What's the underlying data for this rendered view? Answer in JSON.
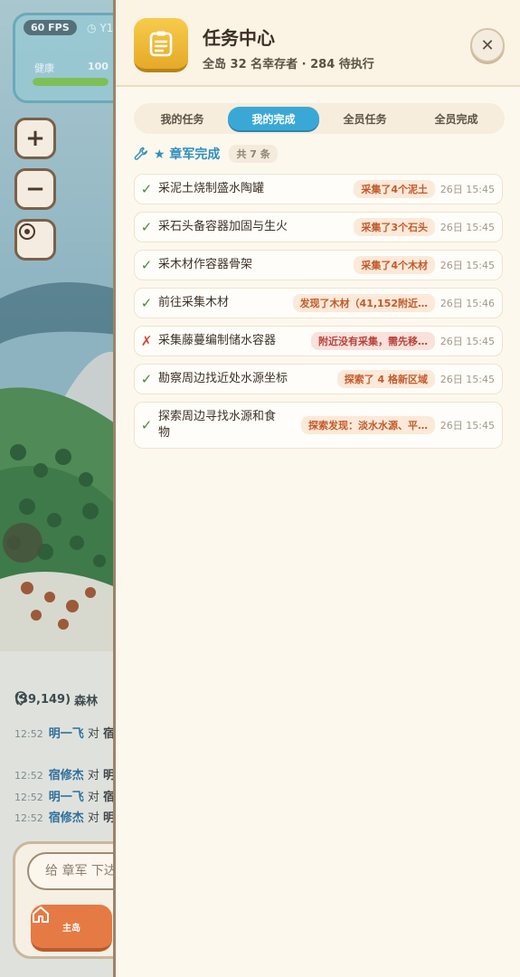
{
  "hud": {
    "fps": "60 FPS",
    "clock": "Y1",
    "health_label": "健康",
    "health_value": "100",
    "health_fraction": 1.0
  },
  "map_controls": {
    "zoom_in": "+",
    "zoom_out": "−"
  },
  "location": {
    "coords": "(39,149)",
    "terrain": "森林"
  },
  "chat_log": [
    {
      "time": "12:52",
      "actor": "明一飞",
      "mid": " 对 ",
      "target": "宿修"
    },
    {
      "time": "12:52",
      "actor": "宿修杰",
      "mid": " 对 ",
      "target": "明一"
    },
    {
      "time": "12:52",
      "actor": "明一飞",
      "mid": " 对 ",
      "target": "宿修"
    },
    {
      "time": "12:52",
      "actor": "宿修杰",
      "mid": " 对 ",
      "target": "明一"
    }
  ],
  "chat": {
    "input_placeholder": "给 章军 下达"
  },
  "bottom_nav": {
    "home_label": "主岛"
  },
  "panel": {
    "title": "任务中心",
    "subtitle": "全岛 32 名幸存者 · 284 待执行",
    "close": "✕",
    "tabs": [
      {
        "label": "我的任务",
        "active": false
      },
      {
        "label": "我的完成",
        "active": true
      },
      {
        "label": "全员任务",
        "active": false
      },
      {
        "label": "全员完成",
        "active": false
      }
    ],
    "section": {
      "title": "★ 章军完成",
      "count": "共 7 条"
    },
    "tasks": [
      {
        "status": "✓",
        "ok": true,
        "name": "采泥土烧制盛水陶罐",
        "result": "采集了4个泥土",
        "time": "26日 15:45"
      },
      {
        "status": "✓",
        "ok": true,
        "name": "采石头备容器加固与生火",
        "result": "采集了3个石头",
        "time": "26日 15:45"
      },
      {
        "status": "✓",
        "ok": true,
        "name": "采木材作容器骨架",
        "result": "采集了4个木材",
        "time": "26日 15:45"
      },
      {
        "status": "✓",
        "ok": true,
        "name": "前往采集木材",
        "result": "发现了木材（41,152附近…",
        "time": "26日 15:46"
      },
      {
        "status": "✗",
        "ok": false,
        "name": "采集藤蔓编制储水容器",
        "result": "附近没有采集，需先移…",
        "time": "26日 15:45"
      },
      {
        "status": "✓",
        "ok": true,
        "name": "勘察周边找近处水源坐标",
        "result": "探索了 4 格新区域",
        "time": "26日 15:45"
      },
      {
        "status": "✓",
        "ok": true,
        "name": "探索周边寻找水源和食物",
        "result": "探索发现：淡水水源、平…",
        "time": "26日 15:45"
      }
    ]
  }
}
